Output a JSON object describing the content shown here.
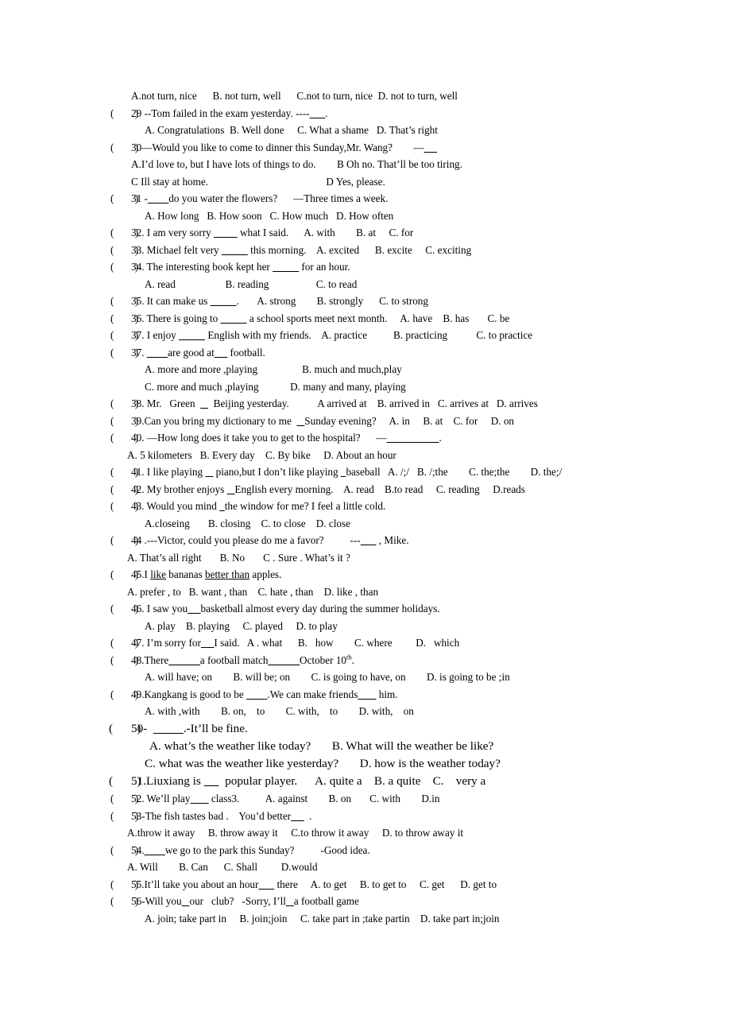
{
  "document": {
    "type": "english-grammar-multiple-choice-worksheet",
    "question_range": "29-56",
    "lines": [
      {
        "id": "l-28-options",
        "indent": "ind-2",
        "marker": "",
        "text": "A.not turn, nice      B. not turn, well      C.not to turn, nice  D. not to turn, well"
      },
      {
        "id": "l-29-stem",
        "indent": "",
        "marker": "(        )",
        "text": "29 --Tom failed in the exam yesterday. ----______."
      },
      {
        "id": "l-29-options",
        "indent": "ind-3",
        "marker": "",
        "text": "A. Congratulations  B. Well done     C. What a shame   D. That’s right"
      },
      {
        "id": "l-30-stem",
        "indent": "",
        "marker": "(        )",
        "text": "30—Would you like to come to dinner this Sunday,Mr. Wang?        —_____"
      },
      {
        "id": "l-30-options-ab",
        "indent": "ind-2",
        "marker": "",
        "text": "A.I’d love to, but I have lots of things to do.        B Oh no. That’ll be too tiring."
      },
      {
        "id": "l-30-options-cd",
        "indent": "ind-2",
        "marker": "",
        "text": "C Ill stay at home.                                             D Yes, please."
      },
      {
        "id": "l-31-stem",
        "indent": "",
        "marker": "(        )",
        "text": "31 -________do you water the flowers?      —Three times a week."
      },
      {
        "id": "l-31-options",
        "indent": "ind-3",
        "marker": "",
        "text": "A. How long   B. How soon   C. How much   D. How often"
      },
      {
        "id": "l-32",
        "indent": "",
        "marker": "(        )",
        "text": "32. I am very sorry _________ what I said.      A. with        B. at     C. for"
      },
      {
        "id": "l-33",
        "indent": "",
        "marker": "(        )",
        "text": "33. Michael felt very __________ this morning.    A. excited      B. excite     C. exciting"
      },
      {
        "id": "l-34-stem",
        "indent": "",
        "marker": "(        )",
        "text": "34. The interesting book kept her __________ for an hour."
      },
      {
        "id": "l-34-options",
        "indent": "ind-3",
        "marker": "",
        "text": "A. read                   B. reading                  C. to read"
      },
      {
        "id": "l-35",
        "indent": "",
        "marker": "(        )",
        "text": "35. It can make us __________.       A. strong        B. strongly      C. to strong"
      },
      {
        "id": "l-36",
        "indent": "",
        "marker": "(        )",
        "text": "36. There is going to __________ a school sports meet next month.     A. have    B. has       C. be"
      },
      {
        "id": "l-37a",
        "indent": "",
        "marker": "(        )",
        "text": "37. I enjoy __________ English with my friends.    A. practice          B. practicing           C. to practice"
      },
      {
        "id": "l-37b-stem",
        "indent": "",
        "marker": "(        )",
        "text": "37. ________are good at_____ football."
      },
      {
        "id": "l-37b-options-ab",
        "indent": "ind-3",
        "marker": "",
        "text": "A. more and more ,playing                 B. much and much,play"
      },
      {
        "id": "l-37b-options-cd",
        "indent": "ind-3",
        "marker": "",
        "text": "C. more and much ,playing            D. many and many, playing"
      },
      {
        "id": "l-38",
        "indent": "",
        "marker": "(        )",
        "text": "38. Mr.   Green  ___  Beijing yesterday.           A arrived at    B. arrived in   C. arrives at   D. arrives"
      },
      {
        "id": "l-39",
        "indent": "",
        "marker": "(        )",
        "text": "39.Can you bring my dictionary to me  ___Sunday evening?     A. in     B. at    C. for     D. on"
      },
      {
        "id": "l-40-stem",
        "indent": "",
        "marker": "(        )",
        "text": "40. —How long does it take you to get to the hospital?      —____________________."
      },
      {
        "id": "l-40-options",
        "indent": "ind-1",
        "marker": "",
        "text": "A. 5 kilometers   B. Every day    C. By bike     D. About an hour"
      },
      {
        "id": "l-41",
        "indent": "",
        "marker": "(        )",
        "text": "41. I like playing ___ piano,but I don’t like playing __baseball   A. /;/   B. /;the        C. the;the        D. the;/"
      },
      {
        "id": "l-42",
        "indent": "",
        "marker": "(        )",
        "text": "42. My brother enjoys ___English every morning.    A. read    B.to read     C. reading     D.reads"
      },
      {
        "id": "l-43-stem",
        "indent": "",
        "marker": "(        )",
        "text": "43. Would you mind __the window for me? I feel a little cold."
      },
      {
        "id": "l-43-options",
        "indent": "ind-3",
        "marker": "",
        "text": "A.closeing       B. closing    C. to close    D. close"
      },
      {
        "id": "l-44-stem",
        "indent": "",
        "marker": "(        )",
        "text": "44 .---Victor, could you please do me a favor?          ---______ , Mike."
      },
      {
        "id": "l-44-options",
        "indent": "ind-1",
        "marker": "",
        "text": "A. That’s all right       B. No       C . Sure . What’s it ?"
      },
      {
        "id": "l-45-stem",
        "indent": "",
        "marker": "(        )",
        "text": "45.I like bananas better than apples.",
        "rich": true
      },
      {
        "id": "l-45-options",
        "indent": "ind-1",
        "marker": "",
        "text": "A. prefer , to   B. want , than    C. hate , than    D. like , than"
      },
      {
        "id": "l-46-stem",
        "indent": "",
        "marker": "(        )",
        "text": "46. I saw you_____basketball almost every day during the summer holidays."
      },
      {
        "id": "l-46-options",
        "indent": "ind-3",
        "marker": "",
        "text": "A. play    B. playing     C. played     D. to play"
      },
      {
        "id": "l-47",
        "indent": "",
        "marker": "(        )",
        "text": "47. I’m sorry for_____I said.   A . what      B.   how        C. where         D.   which"
      },
      {
        "id": "l-48-stem",
        "indent": "",
        "marker": "(        )",
        "text": "48.There______a football match______October 10",
        "rich": true
      },
      {
        "id": "l-48-options",
        "indent": "ind-3",
        "marker": "",
        "text": "A. will have; on        B. will be; on        C. is going to have, on        D. is going to be ;in"
      },
      {
        "id": "l-49-stem",
        "indent": "",
        "marker": "(        )",
        "text": "49.Kangkang is good to be ________.We can make friends_______ him."
      },
      {
        "id": "l-49-options",
        "indent": "ind-3",
        "marker": "",
        "text": "A. with ,with        B. on,    to        C. with,    to        D. with,    on"
      },
      {
        "id": "l-50-stem",
        "indent": "",
        "marker": "(        )",
        "text": "50-  __________.-It’ll be fine.",
        "big": true
      },
      {
        "id": "l-50-options-ab",
        "indent": "ind-4",
        "marker": "",
        "text": "A. what’s the weather like today?       B. What will the weather be like?",
        "big": true
      },
      {
        "id": "l-50-options-cd",
        "indent": "ind-3",
        "marker": "",
        "text": "C. what was the weather like yesterday?       D. how is the weather today?",
        "big": true
      },
      {
        "id": "l-51",
        "indent": "",
        "marker": "(        )",
        "text": "51.Liuxiang is _____  popular player.      A. quite a    B. a quite    C.    very a",
        "big": true
      },
      {
        "id": "l-52",
        "indent": "",
        "marker": "(        )",
        "text": "52. We’ll play_______ class3.          A. against        B. on       C. with        D.in"
      },
      {
        "id": "l-53-stem",
        "indent": "",
        "marker": "(        )",
        "text": "53-The fish tastes bad .    You’d better_____  ."
      },
      {
        "id": "l-53-options",
        "indent": "ind-1",
        "marker": "",
        "text": "A.throw it away     B. throw away it     C.to throw it away     D. to throw away it"
      },
      {
        "id": "l-54-stem",
        "indent": "",
        "marker": "(        )",
        "text": "54.________we go to the park this Sunday?          -Good idea."
      },
      {
        "id": "l-54-options",
        "indent": "ind-1",
        "marker": "",
        "text": "A. Will        B. Can      C. Shall         D.would"
      },
      {
        "id": "l-55",
        "indent": "",
        "marker": "(        )",
        "text": "55.It’ll take you about an hour______ there     A. to get     B. to get to     C. get      D. get to"
      },
      {
        "id": "l-56-stem",
        "indent": "",
        "marker": "(        )",
        "text": "56-Will you___our   club?   -Sorry, I’ll___a football game"
      },
      {
        "id": "l-56-options",
        "indent": "ind-3",
        "marker": "",
        "text": "A. join; take part in     B. join;join     C. take part in ;take partin    D. take part in;join"
      }
    ],
    "rich_lines": {
      "l-45-stem": {
        "prefix": "45.I ",
        "underline_1": "like",
        "middle": " bananas ",
        "underline_2": "better than",
        "suffix": " apples."
      },
      "l-48-stem": {
        "prefix": "48.There",
        "blank_1": "______",
        "middle": "a football match",
        "blank_2": "______",
        "date_text": "October 10",
        "superscript": "th",
        "suffix": "."
      }
    }
  }
}
